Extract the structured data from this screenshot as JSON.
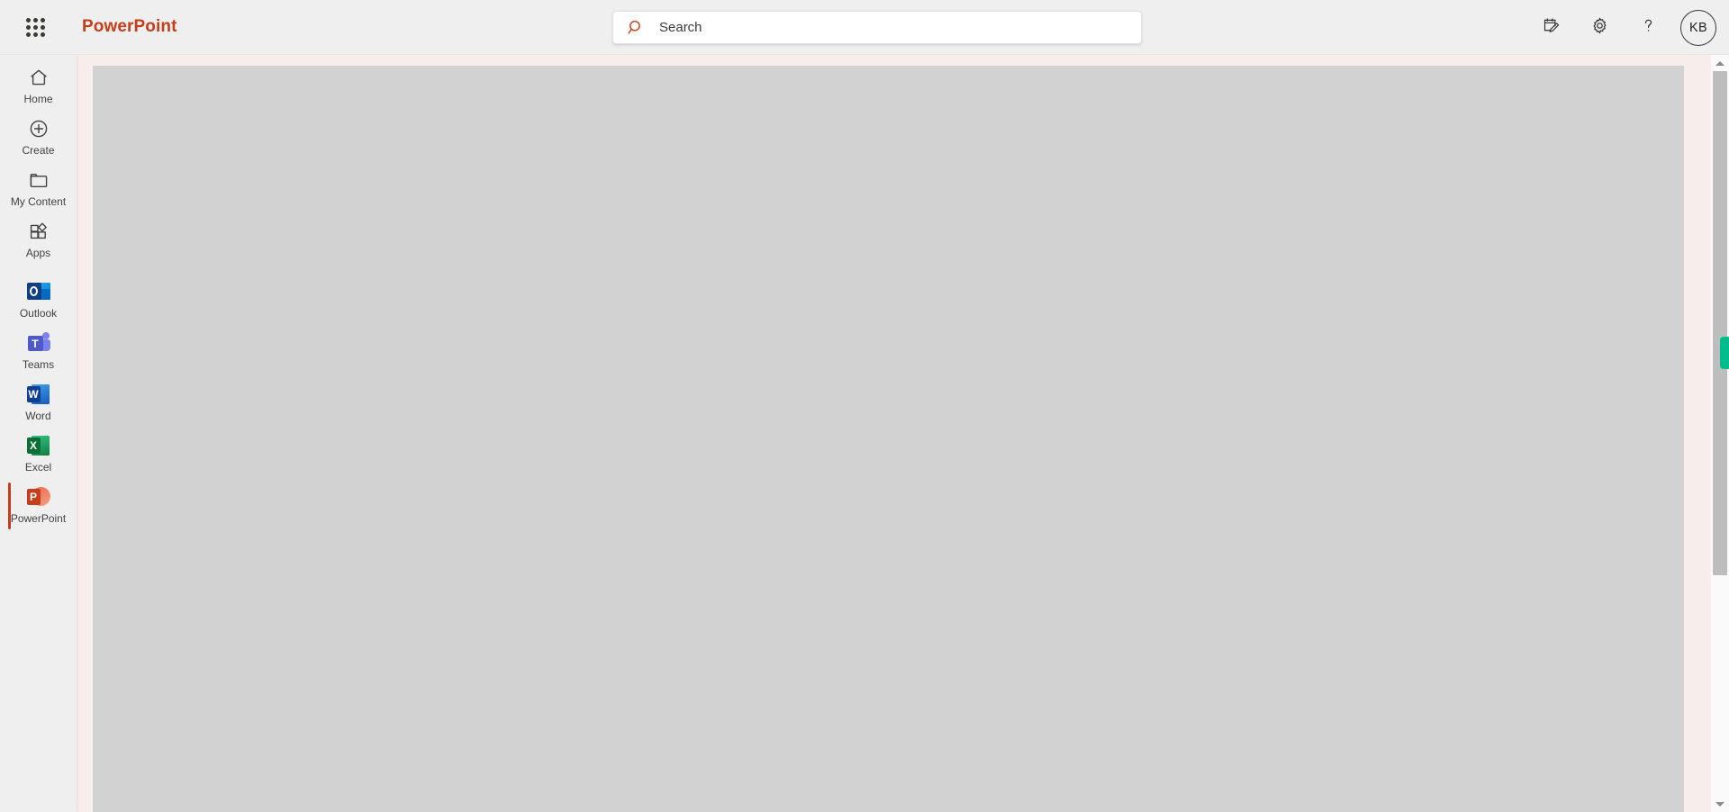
{
  "header": {
    "waffle_name": "waffle-grid-icon",
    "brand_title": "PowerPoint",
    "search": {
      "placeholder": "Search",
      "value": "",
      "icon": "search-icon"
    },
    "actions": [
      {
        "name": "feedback-icon",
        "label": "Feedback"
      },
      {
        "name": "gear-icon",
        "label": "Settings"
      },
      {
        "name": "question-mark-icon",
        "label": "Help"
      }
    ],
    "avatar": {
      "initials": "KB",
      "name": "account-avatar"
    }
  },
  "sidebar": {
    "nav_items": [
      {
        "label": "Home",
        "icon": "home-icon",
        "selected": false
      },
      {
        "label": "Create",
        "icon": "plus-circle-icon",
        "selected": false
      },
      {
        "label": "My Content",
        "icon": "folder-icon",
        "selected": false
      },
      {
        "label": "Apps",
        "icon": "apps-grid-icon",
        "selected": false
      }
    ],
    "app_items": [
      {
        "label": "Outlook",
        "icon": "outlook-icon",
        "selected": false,
        "glyph": "O"
      },
      {
        "label": "Teams",
        "icon": "teams-icon",
        "selected": false,
        "glyph": "T"
      },
      {
        "label": "Word",
        "icon": "word-icon",
        "selected": false,
        "glyph": "W"
      },
      {
        "label": "Excel",
        "icon": "excel-icon",
        "selected": false,
        "glyph": "X"
      },
      {
        "label": "PowerPoint",
        "icon": "powerpoint-icon",
        "selected": true,
        "glyph": "P"
      }
    ]
  },
  "main": {
    "content_state": "blank",
    "canvas_background": "#f7eeec",
    "placeholder_background": "#d2d2d2"
  },
  "scrollbar": {
    "up_arrow": "scroll-up-arrow",
    "down_arrow": "scroll-down-arrow",
    "thumb": "scroll-thumb",
    "marker_color": "#00bd8d"
  },
  "colors": {
    "brand": "#c43e1c",
    "header_bg": "#efefef",
    "rail_bg": "#efefef",
    "canvas": "#f7eeec",
    "placeholder": "#d2d2d2",
    "marker": "#00bd8d"
  }
}
